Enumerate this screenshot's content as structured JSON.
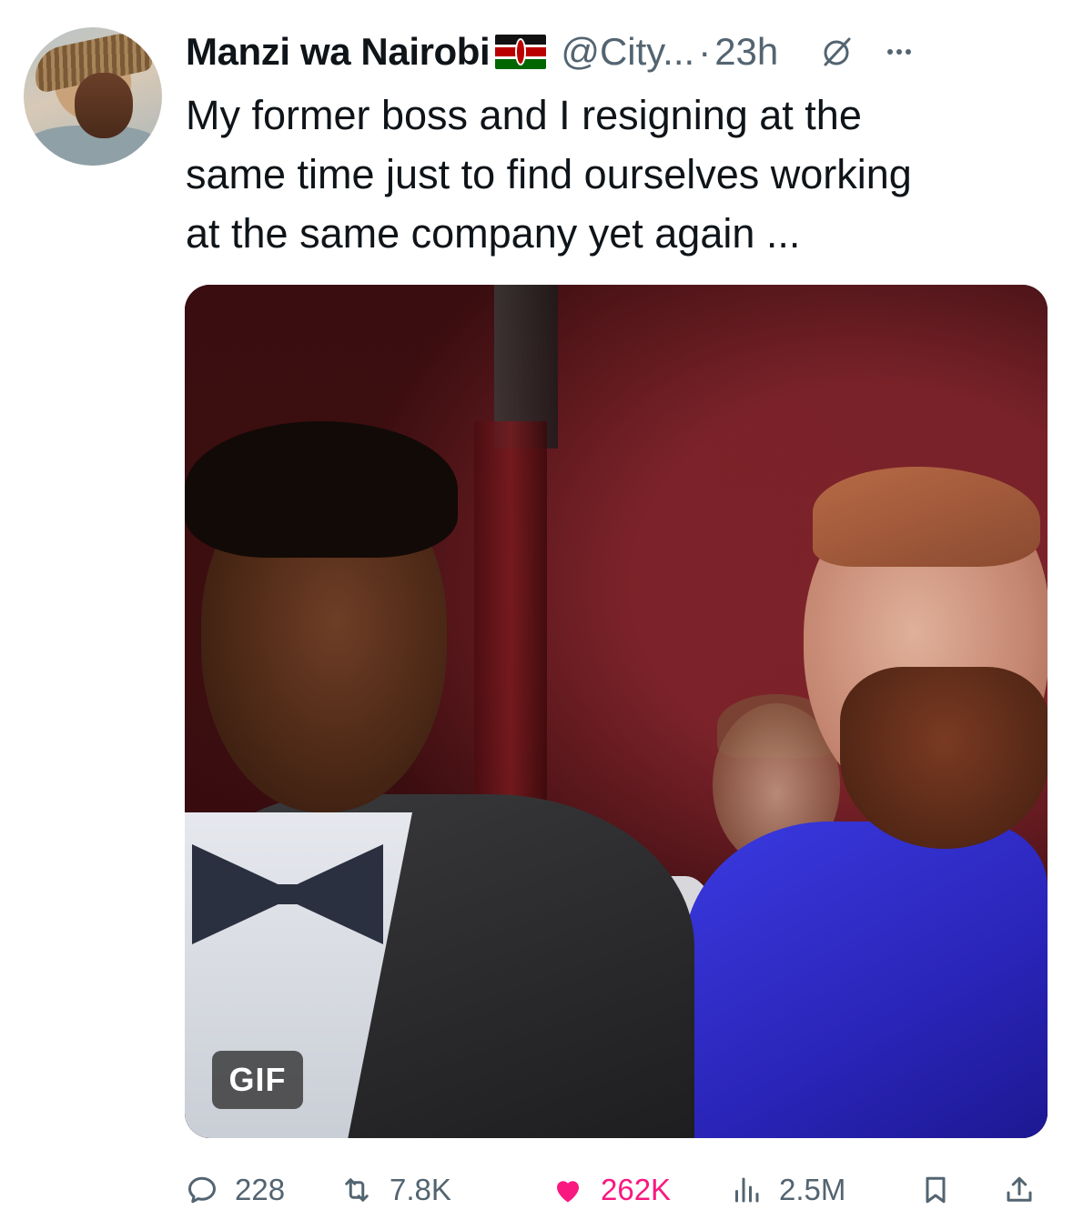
{
  "author": {
    "display_name": "Manzi wa Nairobi",
    "flag": "kenya-flag",
    "handle": "@City...",
    "separator": "·",
    "time": "23h"
  },
  "tweet": {
    "lines": [
      "My former boss and I resigning at the",
      "same time just to find ourselves working",
      "at the same company yet again ..."
    ]
  },
  "media": {
    "badge": "GIF"
  },
  "actions": {
    "replies": "228",
    "reposts": "7.8K",
    "likes": "262K",
    "views": "2.5M"
  },
  "colors": {
    "text": "#0f1419",
    "secondary": "#536471",
    "like_pink": "#f91880"
  }
}
